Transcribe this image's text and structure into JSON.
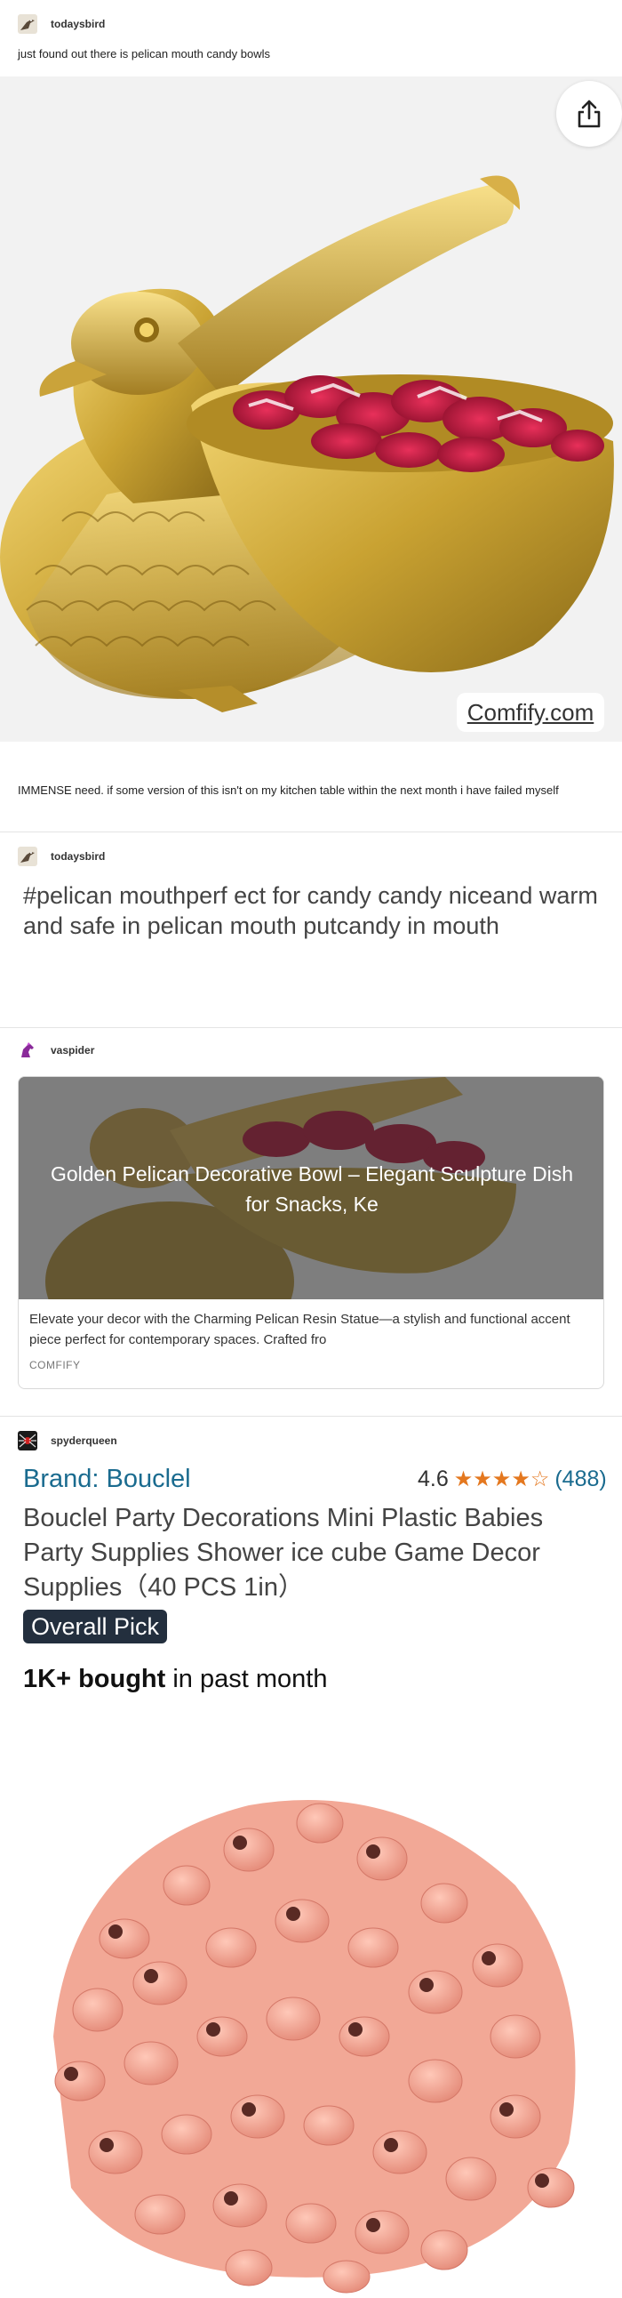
{
  "post": {
    "username": "todaysbird",
    "caption": "just found out there is pelican mouth candy bowls",
    "image_alt": "golden pelican candy bowl",
    "watermark": "Comfify.com",
    "comment": "IMMENSE need. if some version of this isn't on my kitchen table within the next month i have failed myself"
  },
  "reblog1": {
    "username": "todaysbird",
    "tags_text": "#pelican mouthperf ect for candy candy niceand warm and safe in pelican mouth putcandy in mouth"
  },
  "reblog2": {
    "username": "vaspider",
    "link_card": {
      "title": "Golden Pelican Decorative Bowl – Elegant Sculpture Dish for Snacks, Ke",
      "description": "Elevate your decor with the Charming Pelican Resin Statue—a stylish and functional accent piece perfect for contemporary spaces. Crafted fro",
      "source": "COMFIFY"
    }
  },
  "reblog3": {
    "username": "spyderqueen",
    "brand": "Brand: Bouclel",
    "rating": "4.6",
    "review_count": "(488)",
    "product_title": "Bouclel Party Decorations Mini Plastic Babies Party Supplies Shower ice cube Game Decor Supplies（40 PCS 1in）",
    "badge": "Overall Pick",
    "bought_bold": "1K+ bought",
    "bought_rest": " in past month"
  },
  "colors": {
    "link_blue": "#1a6b8f",
    "star_orange": "#e4781f",
    "badge_bg": "#232f3e",
    "gold": "#c9a232"
  },
  "icons": [
    "share-icon",
    "bird-avatar-icon",
    "horse-avatar-icon",
    "spider-avatar-icon",
    "star-icon"
  ]
}
